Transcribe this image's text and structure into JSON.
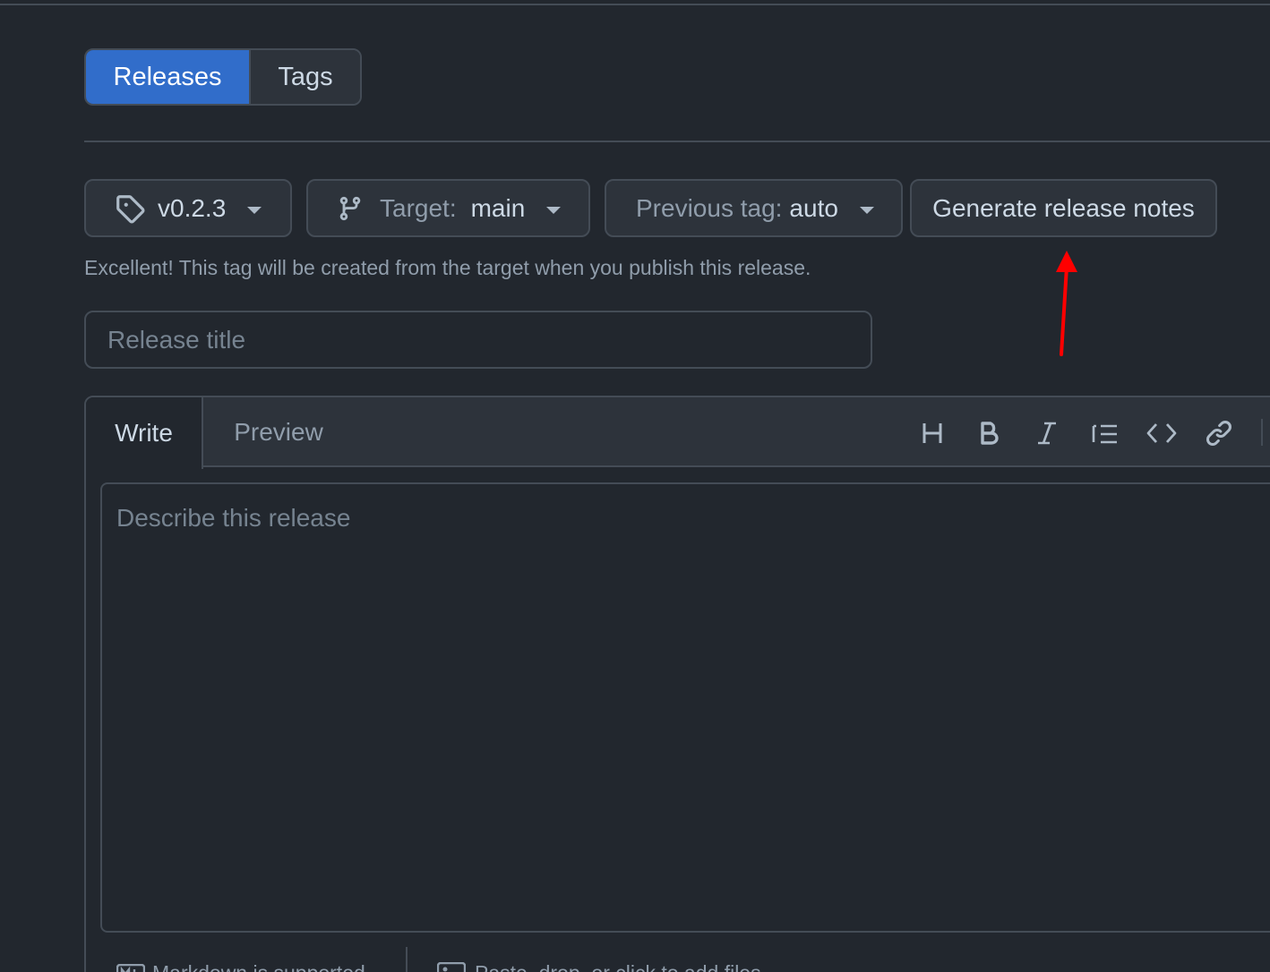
{
  "nav": {
    "releases_label": "Releases",
    "tags_label": "Tags",
    "active": "Releases"
  },
  "pickers": {
    "tag_value": "v0.2.3",
    "target_label": "Target:",
    "target_value": "main",
    "previous_tag_label": "Previous tag:",
    "previous_tag_value": "auto",
    "generate_label": "Generate release notes"
  },
  "hint_text": "Excellent! This tag will be created from the target when you publish this release.",
  "title_input": {
    "placeholder": "Release title",
    "value": ""
  },
  "editor": {
    "tabs": {
      "write": "Write",
      "preview": "Preview"
    },
    "active_tab": "Write",
    "toolbar_icons": [
      "heading-icon",
      "bold-icon",
      "italic-icon",
      "list-icon",
      "code-icon",
      "link-icon"
    ],
    "placeholder": "Describe this release",
    "value": "",
    "footer": {
      "markdown_label": "Markdown is supported",
      "attach_label": "Paste, drop, or click to add files"
    }
  },
  "annotation": {
    "color": "#ff0000"
  },
  "colors": {
    "accent": "#316dca",
    "background": "#22272e",
    "surface": "#2d333b",
    "border": "#444c56"
  }
}
